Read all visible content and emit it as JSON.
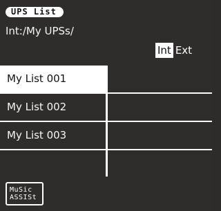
{
  "header": {
    "title": "UPS List",
    "path": "Int:/My UPSs/",
    "storage_toggle": {
      "options": [
        "Int",
        "Ext"
      ],
      "selected": "Int"
    }
  },
  "list": {
    "items": [
      {
        "label": "My List 001",
        "selected": true
      },
      {
        "label": "My List 002",
        "selected": false
      },
      {
        "label": "My List 003",
        "selected": false
      },
      {
        "label": "",
        "selected": false
      }
    ]
  },
  "footer": {
    "music_assist": {
      "line1": "MuSic",
      "line2": "ASSISt"
    }
  }
}
